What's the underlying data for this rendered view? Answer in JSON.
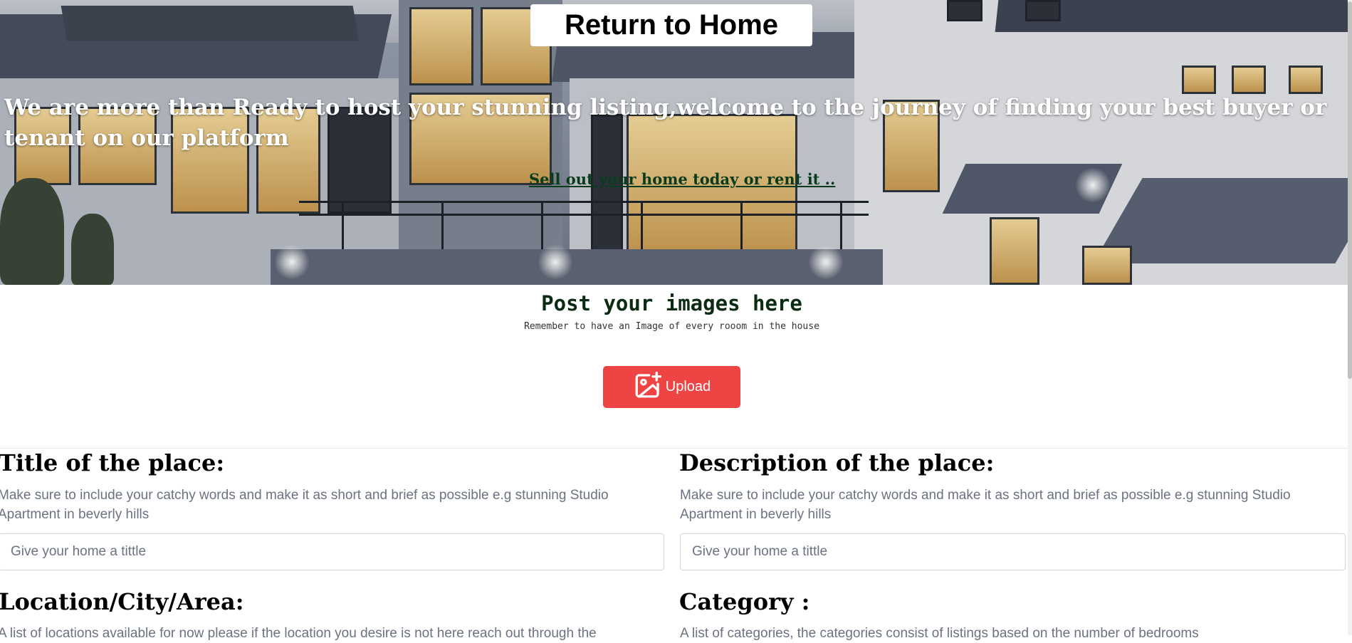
{
  "hero": {
    "return_button": "Return to Home",
    "headline": "We are more than Ready to host your stunning listing,welcome to the journey of finding your best buyer or tenant on our platform",
    "link": "Sell out your home today or rent it .."
  },
  "upload": {
    "title": "Post your images here",
    "subtitle": "Remember to have an Image of every rooom in the house",
    "button_label": "Upload"
  },
  "form": {
    "title": {
      "label": "Title of the place:",
      "help": "Make sure to include your catchy words and make it as short and brief as possible e.g stunning Studio Apartment in beverly hills",
      "placeholder": "Give your home a tittle"
    },
    "description": {
      "label": "Description of the place:",
      "help": "Make sure to include your catchy words and make it as short and brief as possible e.g stunning Studio Apartment in beverly hills",
      "placeholder": "Give your home a tittle"
    },
    "location": {
      "label": "Location/City/Area:",
      "help": "A list of locations available for now please if the location you desire is not here reach out through the"
    },
    "category": {
      "label": "Category :",
      "help": "A list of categories, the categories consist of listings based on the number of bedrooms"
    }
  },
  "colors": {
    "upload_button": "#ef4444",
    "hero_link": "#0b3b1d",
    "post_title": "#0b2b12",
    "help_text": "#6b7280"
  },
  "icons": [
    "add-image-icon"
  ]
}
